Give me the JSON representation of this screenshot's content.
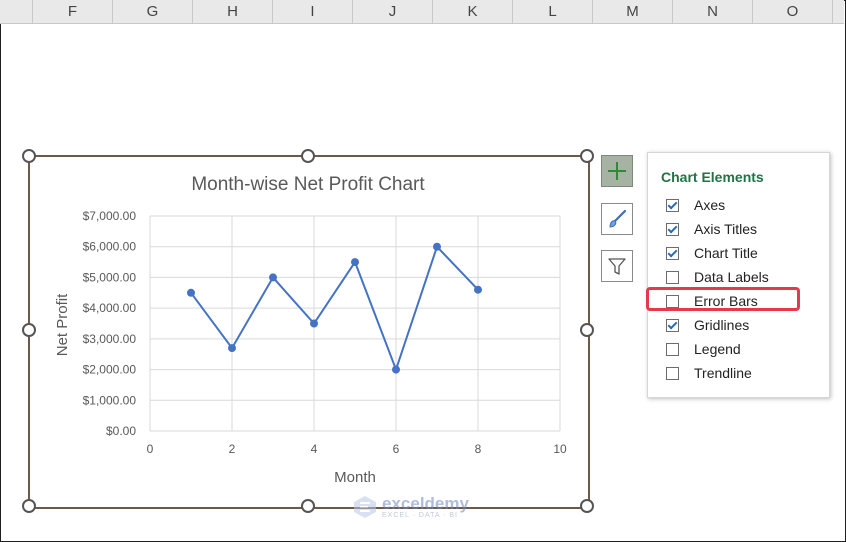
{
  "columns": [
    "F",
    "G",
    "H",
    "I",
    "J",
    "K",
    "L",
    "M",
    "N",
    "O"
  ],
  "chart": {
    "panel_title": "Chart Elements",
    "elements": [
      {
        "label": "Axes",
        "checked": true
      },
      {
        "label": "Axis Titles",
        "checked": true
      },
      {
        "label": "Chart Title",
        "checked": true
      },
      {
        "label": "Data Labels",
        "checked": false
      },
      {
        "label": "Error Bars",
        "checked": false,
        "highlighted": true
      },
      {
        "label": "Gridlines",
        "checked": true
      },
      {
        "label": "Legend",
        "checked": false
      },
      {
        "label": "Trendline",
        "checked": false
      }
    ],
    "buttons": {
      "add": "chart-elements-icon",
      "style": "brush-icon",
      "filter": "filter-icon"
    }
  },
  "watermark": {
    "name": "exceldemy",
    "tagline": "EXCEL · DATA · BI"
  },
  "chart_data": {
    "type": "scatter",
    "title": "Month-wise Net Profit Chart",
    "xlabel": "Month",
    "ylabel": "Net Profit",
    "xlim": [
      0,
      10
    ],
    "ylim": [
      0,
      7000
    ],
    "x_ticks": [
      "0",
      "2",
      "4",
      "6",
      "8",
      "10"
    ],
    "y_ticks": [
      "$0.00",
      "$1,000.00",
      "$2,000.00",
      "$3,000.00",
      "$4,000.00",
      "$5,000.00",
      "$6,000.00",
      "$7,000.00"
    ],
    "x": [
      1,
      2,
      3,
      4,
      5,
      6,
      7,
      8
    ],
    "y": [
      4500,
      2700,
      5000,
      3500,
      5500,
      2000,
      6000,
      4600
    ],
    "grid": true,
    "color": "#4472c4",
    "lines": true
  }
}
